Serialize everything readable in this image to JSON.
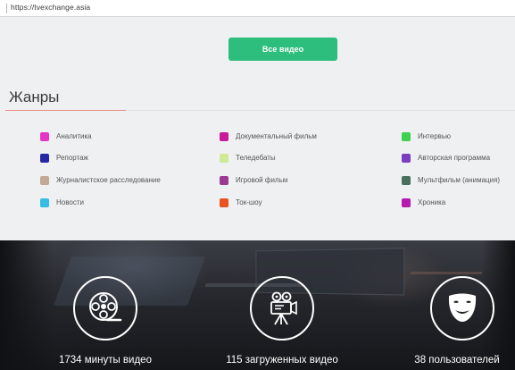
{
  "browser": {
    "url": "https://tvexchange.asia"
  },
  "all_videos_button": "Все видео",
  "genres": {
    "title": "Жанры",
    "items": [
      {
        "label": "Аналитика",
        "color": "#e535c4"
      },
      {
        "label": "Документальный фильм",
        "color": "#c81a9c"
      },
      {
        "label": "Интервью",
        "color": "#3ed14f"
      },
      {
        "label": "Репортаж",
        "color": "#2627a6"
      },
      {
        "label": "Теледебаты",
        "color": "#cdea95"
      },
      {
        "label": "Авторская программа",
        "color": "#7a3fc0"
      },
      {
        "label": "Журналистское расследование",
        "color": "#c2a995"
      },
      {
        "label": "Игровой фильм",
        "color": "#9a3b91"
      },
      {
        "label": "Мультфильм (анимация)",
        "color": "#49705f"
      },
      {
        "label": "Новости",
        "color": "#35bde3"
      },
      {
        "label": "Ток-шоу",
        "color": "#e8531f"
      },
      {
        "label": "Хроника",
        "color": "#b41ab0"
      }
    ]
  },
  "stats": [
    {
      "text": "1734 минуты видео",
      "icon": "film-reel-icon"
    },
    {
      "text": "115 загруженных видео",
      "icon": "video-camera-icon"
    },
    {
      "text": "38 пользователей",
      "icon": "theater-mask-icon"
    }
  ]
}
